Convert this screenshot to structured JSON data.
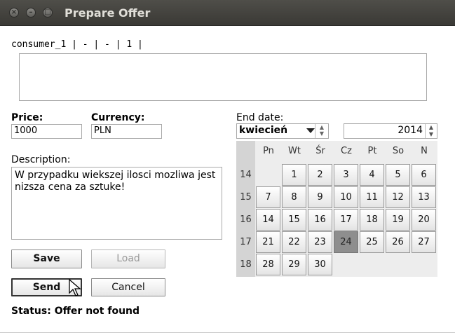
{
  "window": {
    "title": "Prepare Offer"
  },
  "consumer_label": "consumer_1 | - | - | 1 |",
  "price": {
    "label": "Price:",
    "value": "1000"
  },
  "currency": {
    "label": "Currency:",
    "value": "PLN"
  },
  "description": {
    "label": "Description:",
    "text": "W przypadku wiekszej ilosci mozliwa jest nizsza cena za sztuke!"
  },
  "end_date": {
    "label": "End date:",
    "month": "kwiecień",
    "year": "2014",
    "weekdays": [
      "Pn",
      "Wt",
      "Śr",
      "Cz",
      "Pt",
      "So",
      "N"
    ],
    "weeks": [
      {
        "num": "14",
        "days": [
          "",
          "1",
          "2",
          "3",
          "4",
          "5",
          "6"
        ]
      },
      {
        "num": "15",
        "days": [
          "7",
          "8",
          "9",
          "10",
          "11",
          "12",
          "13"
        ]
      },
      {
        "num": "16",
        "days": [
          "14",
          "15",
          "16",
          "17",
          "18",
          "19",
          "20"
        ]
      },
      {
        "num": "17",
        "days": [
          "21",
          "22",
          "23",
          "24",
          "25",
          "26",
          "27"
        ]
      },
      {
        "num": "18",
        "days": [
          "28",
          "29",
          "30",
          "",
          "",
          "",
          ""
        ]
      }
    ],
    "selected_day": "24"
  },
  "buttons": {
    "save": "Save",
    "load": "Load",
    "send": "Send",
    "cancel": "Cancel"
  },
  "status": "Status: Offer not found"
}
